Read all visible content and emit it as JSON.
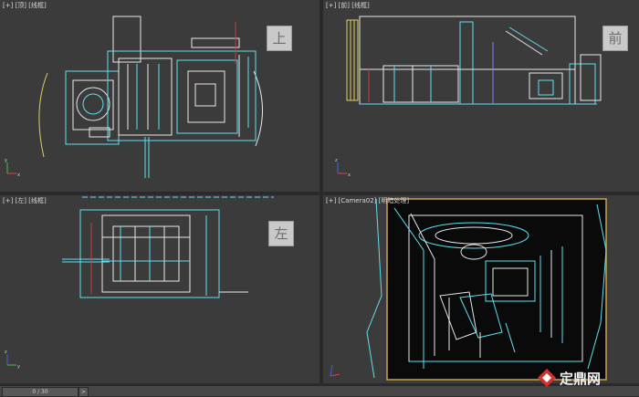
{
  "viewports": {
    "top": {
      "label": "[+] [顶] [线框]",
      "cube": "上"
    },
    "front": {
      "label": "[+] [前] [线框]",
      "cube": "前"
    },
    "left": {
      "label": "[+] [左] [线框]",
      "cube": "左"
    },
    "camera": {
      "label": "[+] [Camera02] [明暗处理]"
    }
  },
  "timeline": {
    "frame": "0 / 30",
    "next": ">"
  },
  "watermark": {
    "text": "定鼎网"
  },
  "colors": {
    "wire_cyan": "#5fe0f0",
    "wire_white": "#e8e8e8",
    "camera_frame": "#c8a24a",
    "viewport_bg": "#3b3b3b"
  }
}
